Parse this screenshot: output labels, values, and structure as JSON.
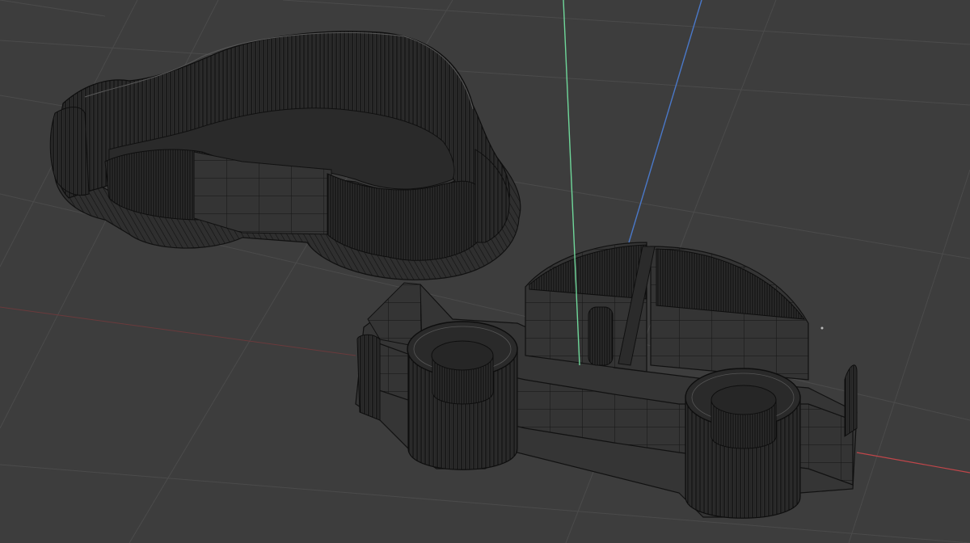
{
  "viewport": {
    "background": "#3d3d3d",
    "grid_color": "#4a4a4a",
    "axis_colors": {
      "x": "#c0464a",
      "y": "#6fd79a",
      "z": "#4a78c8"
    },
    "mesh_fill": "#303030",
    "mesh_wire": "#0f0f0f",
    "mesh_wire_light": "#5a5a5a",
    "objects": [
      "cookie-cutter-outline",
      "cookie-cutter-car-body"
    ]
  }
}
